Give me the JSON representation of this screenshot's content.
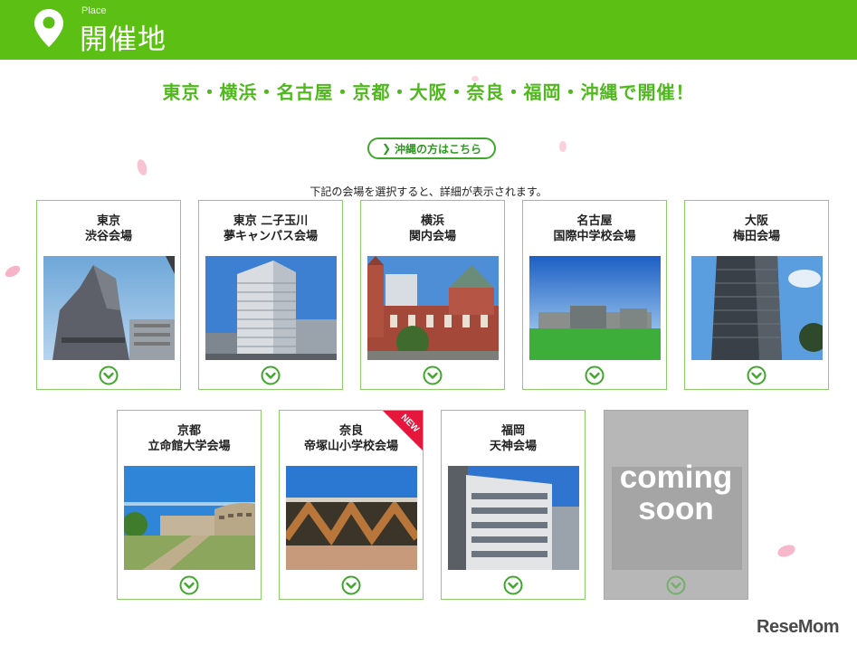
{
  "header": {
    "subtitle": "Place",
    "title": "開催地"
  },
  "headline": "東京・横浜・名古屋・京都・大阪・奈良・福岡・沖縄で開催！",
  "okinawa_link": "沖縄の方はこちら",
  "instruction": "下記の会場を選択すると、詳細が表示されます。",
  "venues": [
    {
      "title": "東京\n渋谷会場"
    },
    {
      "title": "東京 二子玉川\n夢キャンパス会場"
    },
    {
      "title": "横浜\n関内会場"
    },
    {
      "title": "名古屋\n国際中学校会場"
    },
    {
      "title": "大阪\n梅田会場"
    },
    {
      "title": "京都\n立命館大学会場"
    },
    {
      "title": "奈良\n帝塚山小学校会場",
      "badge": "NEW"
    },
    {
      "title": "福岡\n天神会場"
    }
  ],
  "coming_soon": "coming\nsoon",
  "logo": "ReseMom",
  "colors": {
    "brand_green": "#5bbf14",
    "headline_green": "#4fb81c",
    "badge_red": "#e5173d"
  }
}
